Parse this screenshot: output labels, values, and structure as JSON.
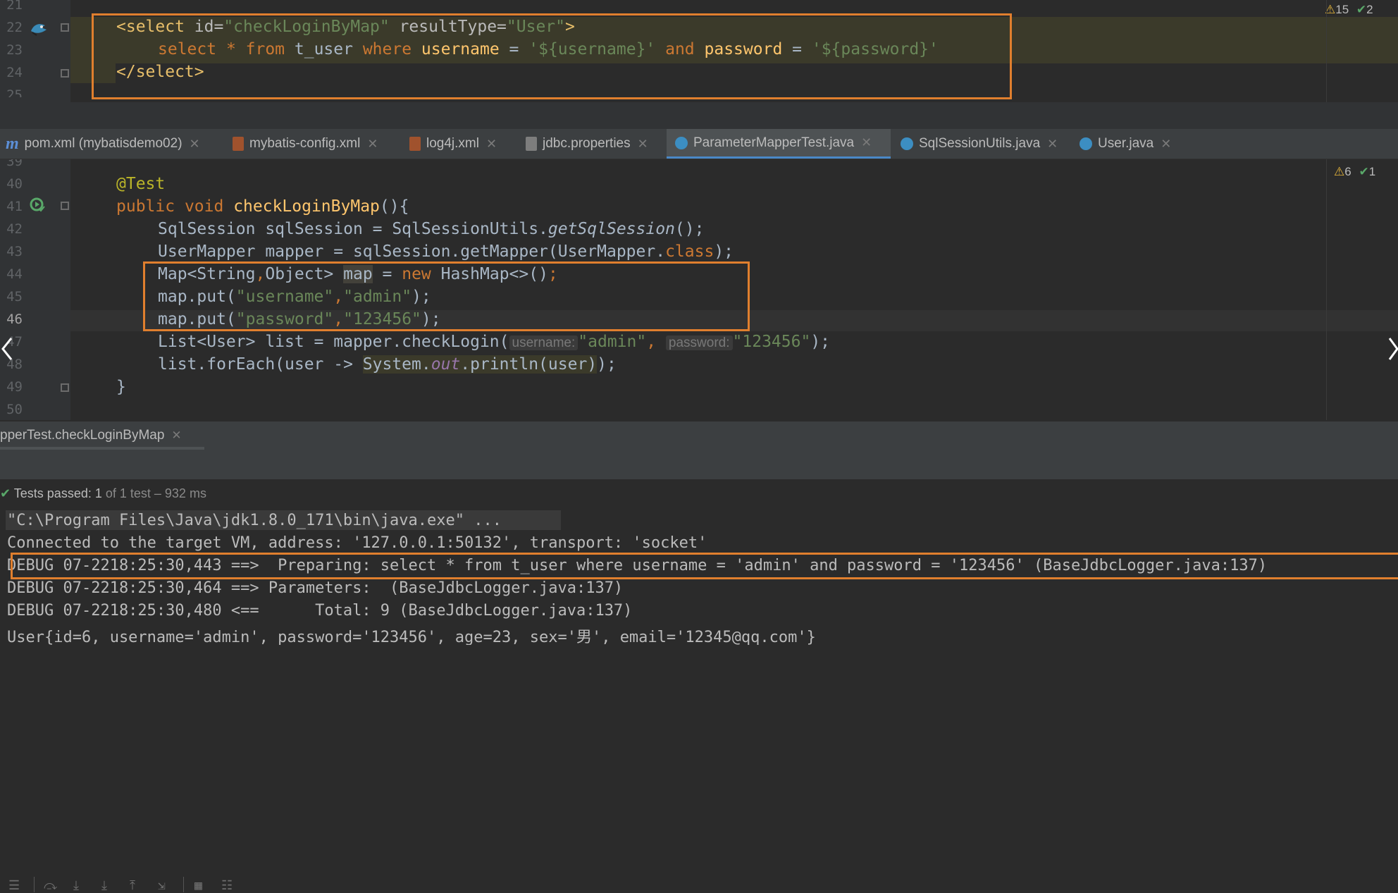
{
  "editor_top": {
    "inspection_warnings": "15",
    "inspection_ok": "2",
    "line_numbers": [
      "21",
      "22",
      "23",
      "24",
      "25"
    ],
    "lines": [
      {
        "select_open": "<select ",
        "id_attr": "id=",
        "id_val": "\"checkLoginByMap\"",
        "rt_attr": " resultType=",
        "rt_val": "\"User\"",
        "close": ">"
      },
      {
        "p1": "select ",
        "p2": "* ",
        "p3": "from ",
        "p4": "t_user ",
        "p5": "where ",
        "p6": "username",
        "p7": " = ",
        "p8": "'${username}'",
        "p9": " and ",
        "p10": "password",
        "p11": " = ",
        "p12": "'${password}'"
      },
      {
        "text": "</select>"
      }
    ]
  },
  "tabs": [
    {
      "label": "pom.xml (mybatisdemo02)",
      "icon": "maven-icon"
    },
    {
      "label": "mybatis-config.xml",
      "icon": "xml-file-icon"
    },
    {
      "label": "log4j.xml",
      "icon": "xml-file-icon"
    },
    {
      "label": "jdbc.properties",
      "icon": "properties-file-icon"
    },
    {
      "label": "ParameterMapperTest.java",
      "icon": "java-class-icon",
      "active": true
    },
    {
      "label": "SqlSessionUtils.java",
      "icon": "java-class-icon"
    },
    {
      "label": "User.java",
      "icon": "java-class-icon"
    }
  ],
  "editor_bottom": {
    "inspection_warnings": "6",
    "inspection_ok": "1",
    "line_numbers": [
      "39",
      "40",
      "41",
      "42",
      "43",
      "44",
      "45",
      "46",
      "47",
      "48",
      "49",
      "50"
    ],
    "annotation": "@Test",
    "l41": {
      "a": "public ",
      "b": "void ",
      "c": "checkLoginByMap",
      "d": "(){"
    },
    "l42": {
      "a": "SqlSession sqlSession = SqlSessionUtils.",
      "b": "getSqlSession",
      "c": "();"
    },
    "l43": {
      "a": "UserMapper mapper = sqlSession.getMapper(UserMapper.",
      "b": "class",
      "c": ");"
    },
    "l44": {
      "a": "Map<String",
      "b": ",",
      "c": "Object> ",
      "d": "map",
      "e": " = ",
      "f": "new ",
      "g": "HashMap<>()",
      "h": ";"
    },
    "l45": {
      "a": "map.put(",
      "b": "\"username\"",
      "c": ",",
      "d": "\"admin\"",
      "e": ");"
    },
    "l46": {
      "a": "map.put(",
      "b": "\"password\"",
      "c": ",",
      "d": "\"123456\"",
      "e": ");"
    },
    "l47": {
      "a": "List<User> list = mapper.checkLogin(",
      "h1": "username:",
      "b": "\"admin\"",
      "c": ", ",
      "h2": "password:",
      "d": "\"123456\"",
      "e": ");"
    },
    "l48": {
      "a": "list.forEach(user -> ",
      "b": "System.",
      "c": "out",
      "d": ".println(user)",
      "e": ");"
    },
    "l49": "}"
  },
  "run_panel": {
    "tab_label": "pperTest.checkLoginByMap",
    "status_prefix": "Tests passed: ",
    "status_count": "1",
    "status_suffix": " of 1 test – 932 ms",
    "console": [
      "\"C:\\Program Files\\Java\\jdk1.8.0_171\\bin\\java.exe\" ...",
      "Connected to the target VM, address: '127.0.0.1:50132', transport: 'socket'",
      "DEBUG 07-2218:25:30,443 ==>  Preparing: select * from t_user where username = 'admin' and password = '123456' (BaseJdbcLogger.java:137)",
      "DEBUG 07-2218:25:30,464 ==> Parameters:  (BaseJdbcLogger.java:137)",
      "DEBUG 07-2218:25:30,480 <==      Total: 9 (BaseJdbcLogger.java:137)",
      "User{id=6, username='admin', password='123456', age=23, sex='男', email='12345@qq.com'}"
    ]
  },
  "colors": {
    "highlight_box": "#e07f2e",
    "active_tab_underline": "#4a88c7",
    "pass_green": "#59a869"
  }
}
